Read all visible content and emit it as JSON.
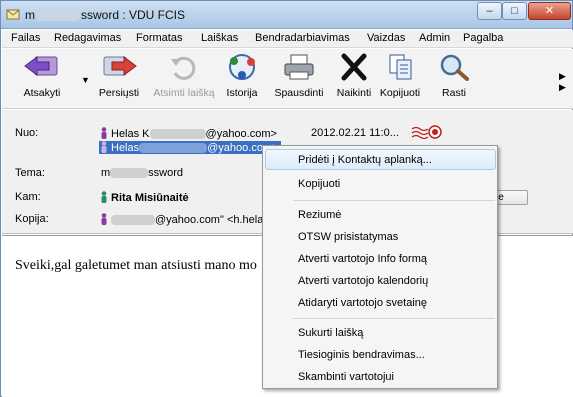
{
  "window": {
    "title_prefix": "m",
    "title_suffix": "ssword : VDU FCIS",
    "min_symbol": "‒",
    "max_symbol": "□",
    "close_symbol": "✕"
  },
  "menubar": [
    "Failas",
    "Redagavimas",
    "Formatas",
    "Laiškas",
    "Bendradarbiavimas",
    "Vaizdas",
    "Admin",
    "Pagalba"
  ],
  "toolbar": {
    "reply": "Atsakyti",
    "forward": "Persiųsti",
    "recall": "Atsimti laišką",
    "history": "Istorija",
    "print": "Spausdinti",
    "delete": "Naikinti",
    "copy": "Kopijuoti",
    "find": "Rasti"
  },
  "header": {
    "from_label": "Nuo:",
    "from_line1_name": "Helas K",
    "from_line1_domain": "@yahoo.com>",
    "from_line2_name": "Helas",
    "from_line2_domain": "@yahoo.com>",
    "date": "2012.02.21 11:0...",
    "subject_label": "Tema:",
    "subject_prefix": "m",
    "subject_suffix": "ssword",
    "to_label": "Kam:",
    "to_name": "Rita Misiūnaitė",
    "cc_label": "Kopija:",
    "cc_domain": "@yahoo.com\"",
    "cc_next": "<h.helas",
    "side_button": "le"
  },
  "body": {
    "text": "Sveiki,gal galetumet man atsiusti mano mo"
  },
  "context_menu": {
    "group1": [
      "Pridėti į Kontaktų aplanką...",
      "Kopijuoti"
    ],
    "group2": [
      "Reziumė",
      "OTSW prisistatymas",
      "Atverti vartotojo Info formą",
      "Atverti vartotojo kalendorių",
      "Atidaryti vartotojo svetainę"
    ],
    "group3": [
      "Sukurti laišką",
      "Tiesioginis bendravimas...",
      "Skambinti vartotojui"
    ]
  }
}
